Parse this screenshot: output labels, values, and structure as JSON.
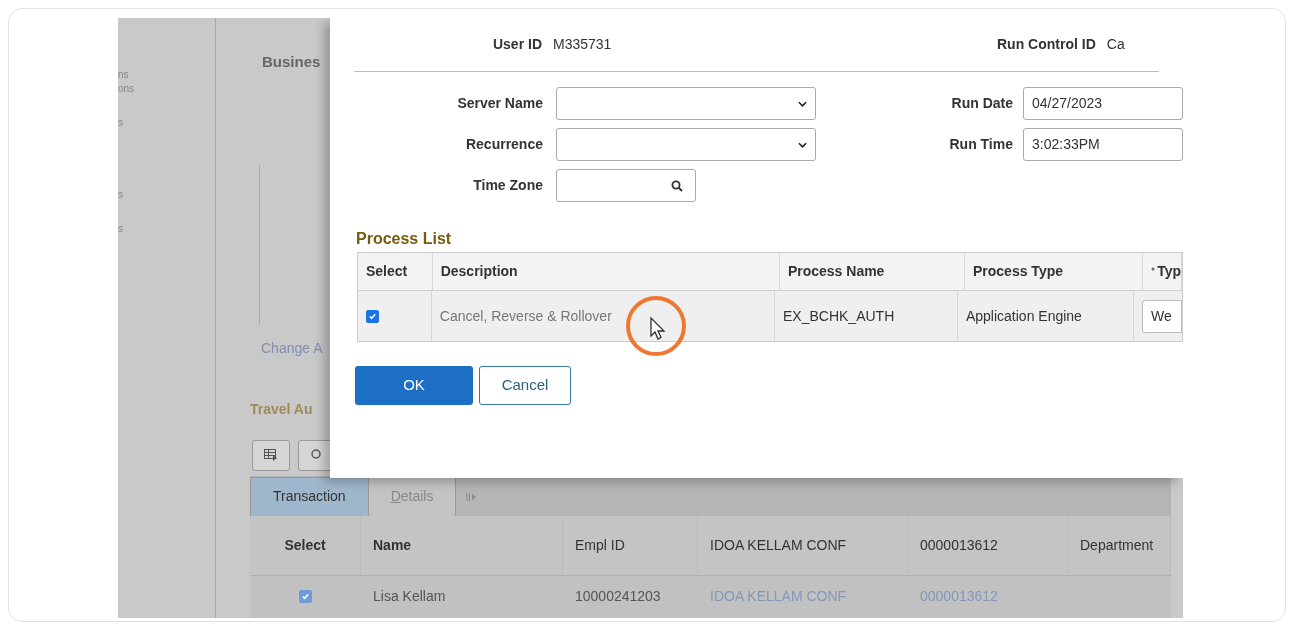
{
  "sidebar": {
    "items": [
      "ns",
      "ons",
      "s",
      "s",
      "s"
    ]
  },
  "page": {
    "title": "Busines",
    "link": "Change A",
    "section_title": "Travel Au",
    "tabs": [
      {
        "label": "Transaction",
        "selected": true
      },
      {
        "label": "Details",
        "selected": false
      }
    ],
    "table": {
      "columns": [
        "Select",
        "Name",
        "Empl ID",
        "IDOA KELLAM CONF",
        "0000013612",
        "Department"
      ],
      "rows": [
        {
          "checked": true,
          "name": "Lisa Kellam",
          "empl_id": "10000241203",
          "column_4": "IDOA KELLAM CONF",
          "column_5": "0000013612"
        }
      ]
    }
  },
  "dialog": {
    "user_id_label": "User ID",
    "user_id": "M335731",
    "run_control_label": "Run Control ID",
    "run_control": "Ca",
    "fields": [
      {
        "label": "Server Name",
        "kind": "select"
      },
      {
        "label": "Recurrence",
        "kind": "select"
      },
      {
        "label": "Time Zone",
        "kind": "lookup"
      }
    ],
    "right_fields": [
      {
        "label": "Run Date",
        "value": "04/27/2023"
      },
      {
        "label": "Run Time",
        "value": "3:02:33PM"
      }
    ],
    "process_list": {
      "title": "Process List",
      "columns": [
        "Select",
        "Description",
        "Process Name",
        "Process Type",
        "Typ"
      ],
      "rows": [
        {
          "checked": true,
          "description": "Cancel, Reverse & Rollover",
          "process_name": "EX_BCHK_AUTH",
          "process_type": "Application Engine",
          "type": "We"
        }
      ]
    },
    "buttons": [
      {
        "label": "OK",
        "kind": "primary"
      },
      {
        "label": "Cancel",
        "kind": "secondary"
      }
    ]
  }
}
